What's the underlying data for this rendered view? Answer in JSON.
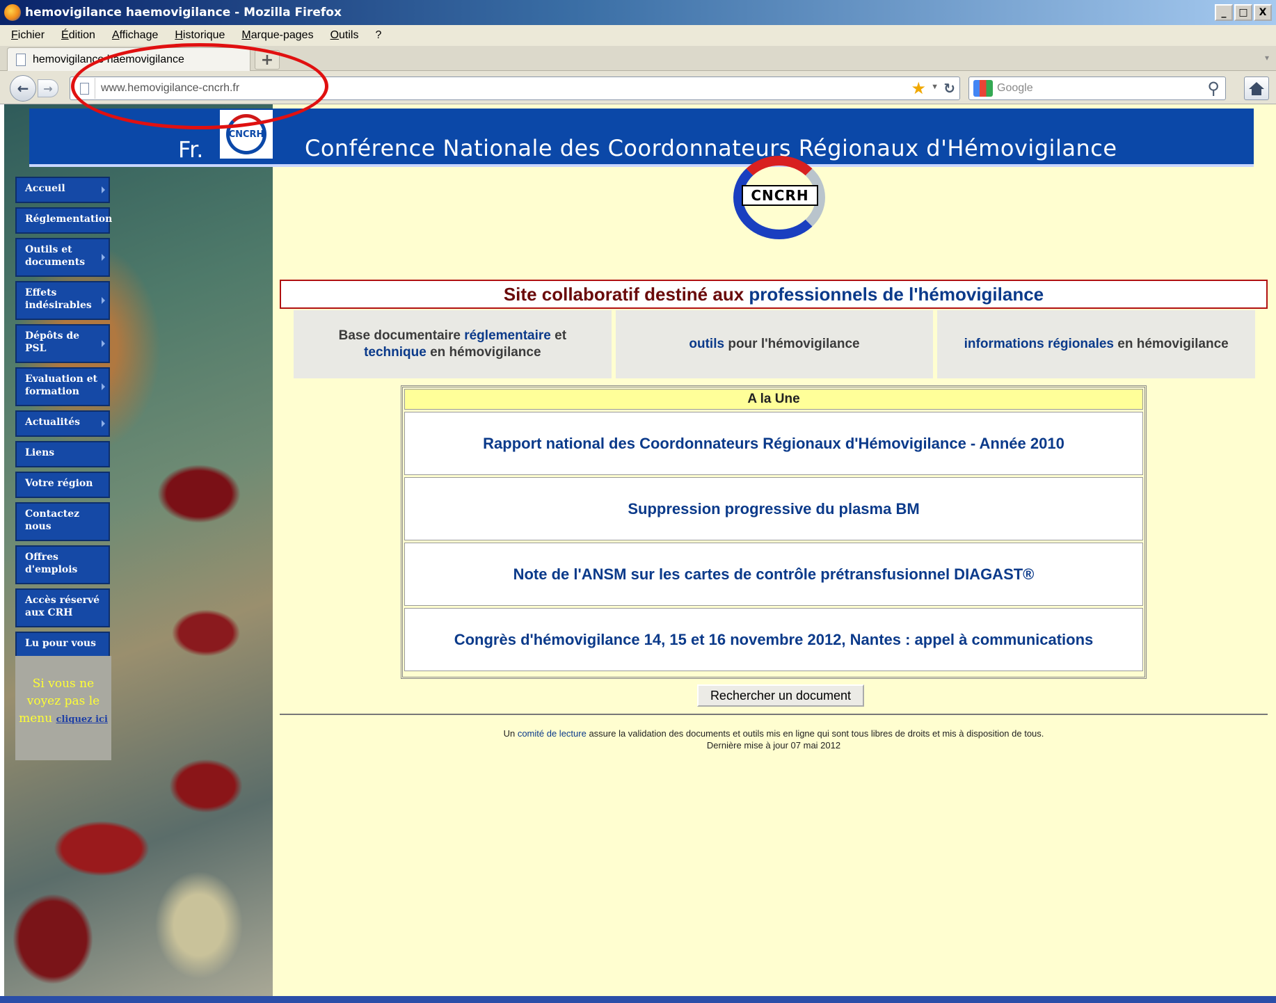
{
  "window": {
    "title": "hemovigilance haemovigilance - Mozilla Firefox",
    "buttons": [
      "_",
      "□",
      "X"
    ]
  },
  "menubar": [
    "Fichier",
    "Édition",
    "Affichage",
    "Historique",
    "Marque-pages",
    "Outils",
    "?"
  ],
  "tab": {
    "label": "hemovigilance haemovigilance",
    "new_tab": "+"
  },
  "navbar": {
    "url": "www.hemovigilance-cncrh.fr",
    "search_placeholder": "Google"
  },
  "header": {
    "lang": "Fr.",
    "logo_text": "CNCRH",
    "title": "Conférence Nationale des Coordonnateurs Régionaux d'Hémovigilance"
  },
  "sidebar": {
    "items": [
      {
        "label": "Accueil",
        "arrow": true
      },
      {
        "label": "Réglementation",
        "arrow": false
      },
      {
        "label": "Outils et documents",
        "arrow": true
      },
      {
        "label": "Effets indésirables",
        "arrow": true
      },
      {
        "label": "Dépôts de PSL",
        "arrow": true
      },
      {
        "label": "Evaluation et formation",
        "arrow": true
      },
      {
        "label": "Actualités",
        "arrow": true
      },
      {
        "label": "Liens",
        "arrow": false
      },
      {
        "label": "Votre région",
        "arrow": false
      },
      {
        "label": "Contactez nous",
        "arrow": false
      },
      {
        "label": "Offres d'emplois",
        "arrow": false
      },
      {
        "label": "Accès réservé aux CRH",
        "arrow": false
      },
      {
        "label": "Lu pour vous",
        "arrow": false
      }
    ],
    "note_text": "Si vous ne voyez pas le menu",
    "note_link": "cliquez ici"
  },
  "main": {
    "logo_text": "CNCRH",
    "tagline_part1": "Site collaboratif destiné aux ",
    "tagline_part2": "professionnels de l'hémovigilance",
    "categories": [
      {
        "a": "Base documentaire ",
        "b": "réglementaire",
        "c": " et ",
        "d": "technique",
        "e": " en hémovigilance"
      },
      {
        "a": "",
        "b": "outils",
        "c": " pour l'hémovigilance",
        "d": "",
        "e": ""
      },
      {
        "a": "",
        "b": "informations régionales",
        "c": " en hémovigilance",
        "d": "",
        "e": ""
      }
    ],
    "une_title": "A la Une",
    "une_items": [
      "Rapport national des Coordonnateurs Régionaux d'Hémovigilance - Année 2010",
      "Suppression progressive du plasma BM",
      "Note de l'ANSM sur les cartes de contrôle prétransfusionnel DIAGAST®",
      "Congrès d'hémovigilance 14, 15 et 16 novembre 2012, Nantes : appel à communications"
    ],
    "search_button": "Rechercher un document",
    "footer_pre": "Un ",
    "footer_link": "comité de lecture",
    "footer_post": " assure la validation des documents et outils mis en ligne qui sont tous libres de droits et mis à disposition de tous.",
    "footer_update": "Dernière mise à jour 07 mai 2012"
  },
  "colors": {
    "header_blue": "#0b48a8",
    "page_bg": "#fffed0",
    "annotation_red": "#e01010"
  }
}
